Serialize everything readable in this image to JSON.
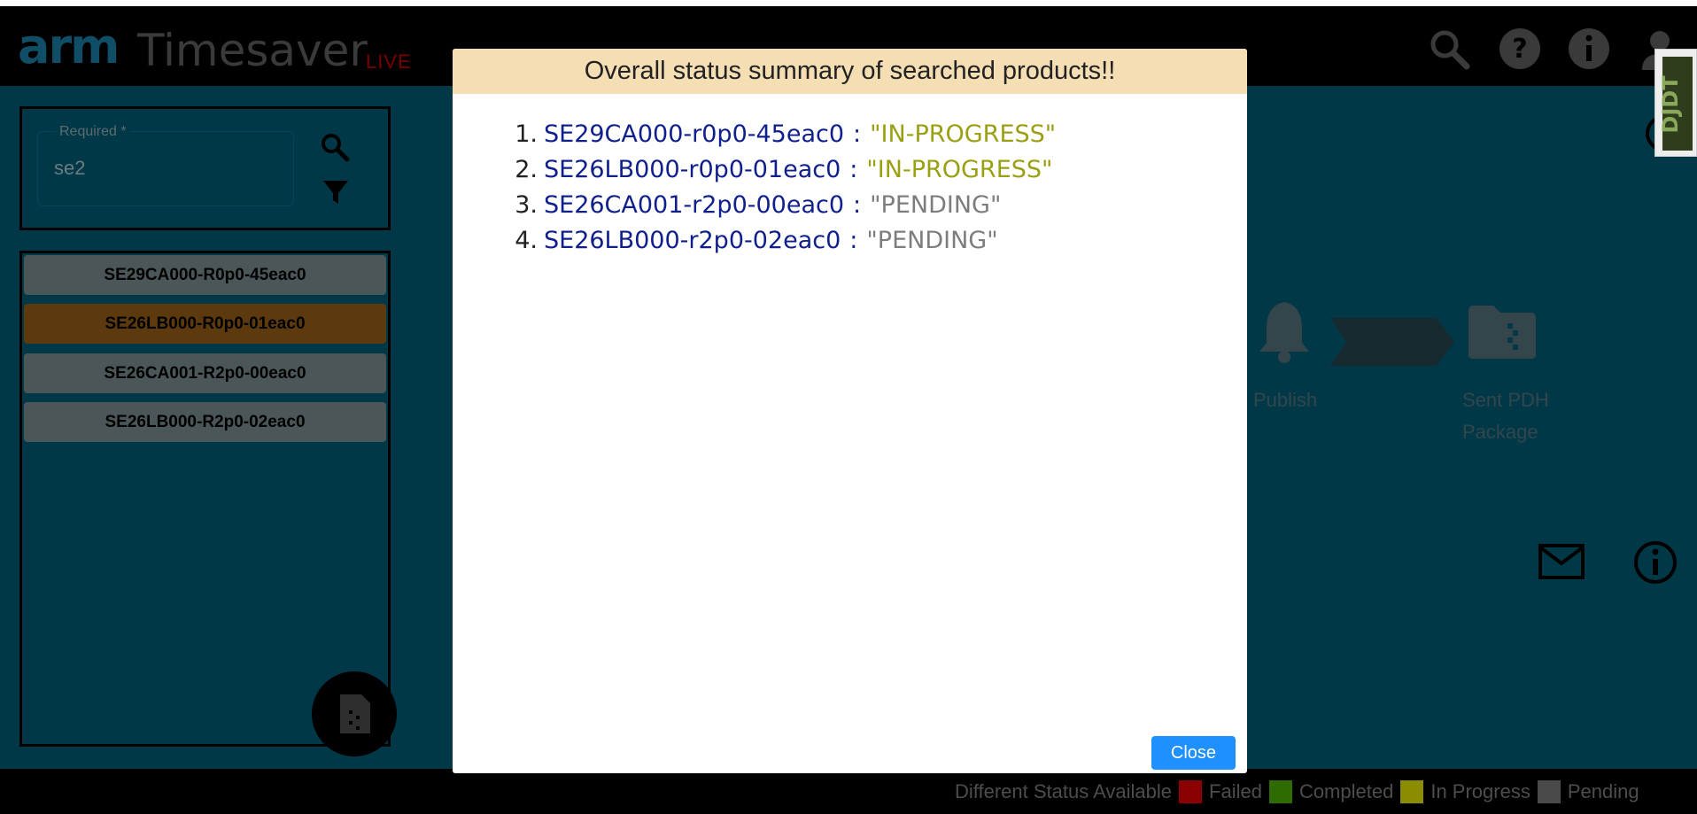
{
  "app": {
    "logo_brand": "arm",
    "logo_title": "Timesaver",
    "logo_badge": "LIVE"
  },
  "search": {
    "field_label": "Required *",
    "field_value": "se2"
  },
  "products": [
    {
      "label": "SE29CA000-R0p0-45eac0",
      "active": false
    },
    {
      "label": "SE26LB000-R0p0-01eac0",
      "active": true
    },
    {
      "label": "SE26CA001-R2p0-00eac0",
      "active": false
    },
    {
      "label": "SE26LB000-R2p0-02eac0",
      "active": false
    }
  ],
  "pipeline": {
    "publish_label": "Publish",
    "sent_label_line1": "Sent PDH",
    "sent_label_line2": "Package"
  },
  "legend": {
    "title": "Different Status Available",
    "items": [
      {
        "label": "Failed",
        "color": "#8b0000"
      },
      {
        "label": "Completed",
        "color": "#2e6b00"
      },
      {
        "label": "In Progress",
        "color": "#8c8c00"
      },
      {
        "label": "Pending",
        "color": "#4a4a4a"
      }
    ]
  },
  "modal": {
    "title": "Overall status summary of searched products!!",
    "items": [
      {
        "num": "1.",
        "code": "SE29CA000-r0p0-45eac0",
        "sep": ":",
        "status": "\"IN-PROGRESS\""
      },
      {
        "num": "2.",
        "code": "SE26LB000-r0p0-01eac0",
        "sep": ":",
        "status": "\"IN-PROGRESS\""
      },
      {
        "num": "3.",
        "code": "SE26CA001-r2p0-00eac0",
        "sep": ":",
        "status": "\"PENDING\""
      },
      {
        "num": "4.",
        "code": "SE26LB000-r2p0-02eac0",
        "sep": ":",
        "status": "\"PENDING\""
      }
    ],
    "close_label": "Close"
  },
  "colors": {
    "in_progress": "#9aa012",
    "pending": "#7d7d7d",
    "code": "#0f1f8c",
    "modal_header": "#f5deb3",
    "close_button": "#1e90ff"
  }
}
